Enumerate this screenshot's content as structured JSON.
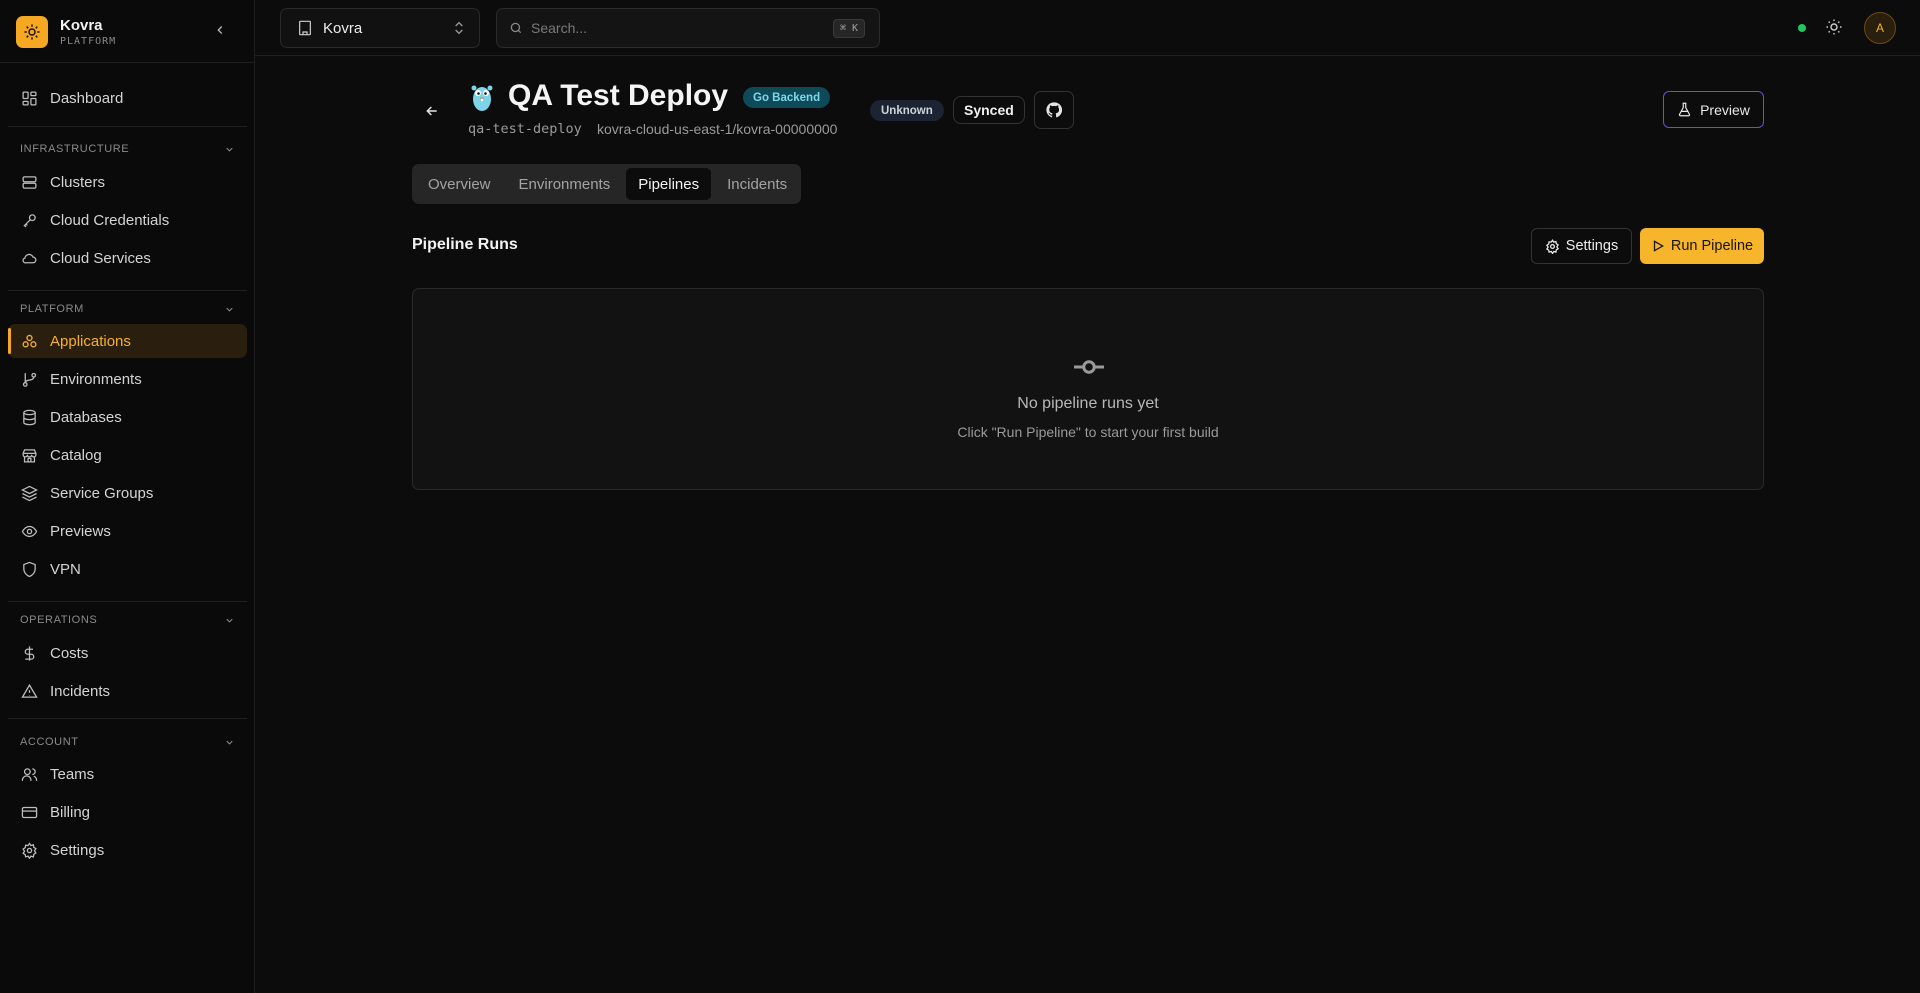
{
  "brand": {
    "name": "Kovra",
    "subtitle": "PLATFORM"
  },
  "sidebar": {
    "top": [
      {
        "label": "Dashboard",
        "icon": "dashboard-icon"
      }
    ],
    "sections": [
      {
        "title": "INFRASTRUCTURE",
        "items": [
          {
            "label": "Clusters",
            "icon": "server-icon"
          },
          {
            "label": "Cloud Credentials",
            "icon": "key-icon"
          },
          {
            "label": "Cloud Services",
            "icon": "cloud-icon"
          }
        ]
      },
      {
        "title": "PLATFORM",
        "items": [
          {
            "label": "Applications",
            "icon": "applications-icon",
            "active": true
          },
          {
            "label": "Environments",
            "icon": "git-branch-icon"
          },
          {
            "label": "Databases",
            "icon": "database-icon"
          },
          {
            "label": "Catalog",
            "icon": "store-icon"
          },
          {
            "label": "Service Groups",
            "icon": "layers-icon"
          },
          {
            "label": "Previews",
            "icon": "eye-icon"
          },
          {
            "label": "VPN",
            "icon": "shield-icon"
          }
        ]
      },
      {
        "title": "OPERATIONS",
        "items": [
          {
            "label": "Costs",
            "icon": "dollar-icon"
          },
          {
            "label": "Incidents",
            "icon": "alert-triangle-icon"
          }
        ]
      },
      {
        "title": "ACCOUNT",
        "items": [
          {
            "label": "Teams",
            "icon": "users-icon"
          },
          {
            "label": "Billing",
            "icon": "credit-card-icon"
          },
          {
            "label": "Settings",
            "icon": "gear-icon"
          }
        ]
      }
    ]
  },
  "topbar": {
    "org": "Kovra",
    "search_placeholder": "Search...",
    "shortcut": "⌘ K",
    "avatar_initial": "A"
  },
  "app": {
    "title": "QA Test Deploy",
    "language_badge": "Go Backend",
    "health_badge": "Unknown",
    "sync_badge": "Synced",
    "slug": "qa-test-deploy",
    "cluster_path": "kovra-cloud-us-east-1/kovra-00000000",
    "preview_label": "Preview"
  },
  "tabs": [
    {
      "label": "Overview"
    },
    {
      "label": "Environments"
    },
    {
      "label": "Pipelines",
      "active": true
    },
    {
      "label": "Incidents"
    }
  ],
  "pipelines": {
    "section_title": "Pipeline Runs",
    "settings_label": "Settings",
    "run_label": "Run Pipeline",
    "empty_title": "No pipeline runs yet",
    "empty_subtitle": "Click \"Run Pipeline\" to start your first build"
  },
  "colors": {
    "accent": "#f6a823",
    "status_online": "#22c55e",
    "preview_border": "#6d4ce0",
    "language_badge_bg": "#0e4a5a"
  }
}
